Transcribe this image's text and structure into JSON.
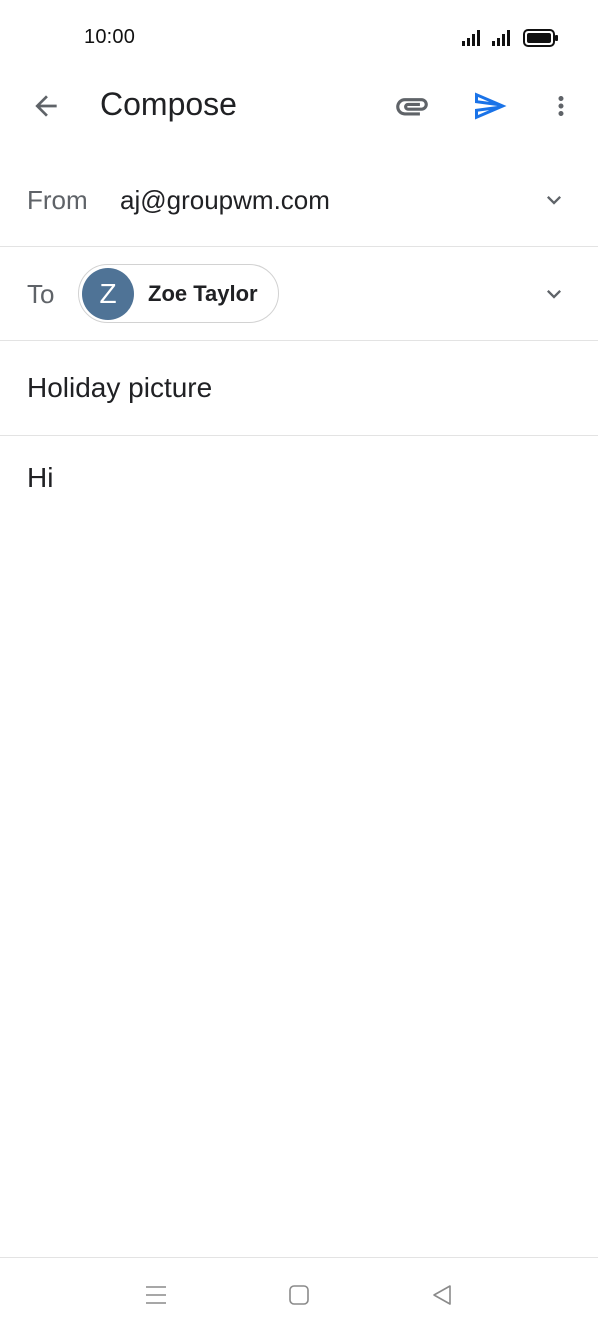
{
  "status_bar": {
    "time": "10:00"
  },
  "app_bar": {
    "title": "Compose",
    "icons": {
      "back": "arrow-back-icon",
      "attach": "paperclip-icon",
      "send": "send-icon",
      "more": "more-vert-icon"
    }
  },
  "from": {
    "label": "From",
    "value": "aj@groupwm.com"
  },
  "to": {
    "label": "To",
    "recipient": {
      "initial": "Z",
      "name": "Zoe Taylor"
    }
  },
  "subject": {
    "value": "Holiday picture"
  },
  "body": {
    "value": "Hi"
  },
  "colors": {
    "accent": "#1a73e8",
    "avatar": "#4f7396"
  }
}
